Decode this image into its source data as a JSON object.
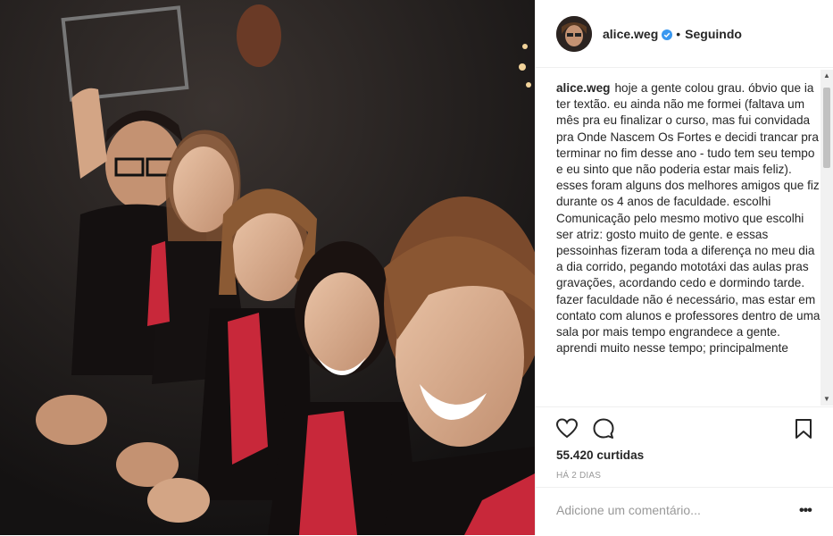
{
  "post": {
    "username": "alice.weg",
    "separator": "•",
    "follow_status": "Seguindo",
    "verified": true
  },
  "caption": {
    "username": "alice.weg",
    "paragraph1": "hoje a gente colou grau. óbvio que ia ter textão. eu ainda não me formei (faltava um mês pra eu finalizar o curso, mas fui convidada pra Onde Nascem Os Fortes e decidi trancar pra terminar no fim desse ano - tudo tem seu tempo e eu sinto que não poderia estar mais feliz). esses foram alguns dos melhores amigos que fiz durante os 4 anos de faculdade. escolhi Comunicação pelo mesmo motivo que escolhi ser atriz: gosto muito de gente. e essas pessoinhas fizeram toda a diferença no meu dia a dia corrido, pegando mototáxi das aulas pras gravações, acordando cedo e dormindo tarde. fazer faculdade não é necessário, mas estar em contato com alunos e professores dentro de uma sala por mais tempo engrandece a gente.",
    "paragraph2": "aprendi muito nesse tempo; principalmente"
  },
  "engagement": {
    "likes": "55.420 curtidas",
    "time_ago": "HÁ 2 DIAS"
  },
  "comment": {
    "placeholder": "Adicione um comentário...",
    "options": "•••"
  },
  "icons": {
    "like": "heart-icon",
    "comment": "comment-icon",
    "save": "bookmark-icon",
    "verified": "verified-badge-icon",
    "options": "more-options-icon"
  },
  "colors": {
    "text": "#262626",
    "muted": "#999999",
    "verified_blue": "#3897f0",
    "border": "#efefef",
    "gown_red": "#c8283a"
  }
}
